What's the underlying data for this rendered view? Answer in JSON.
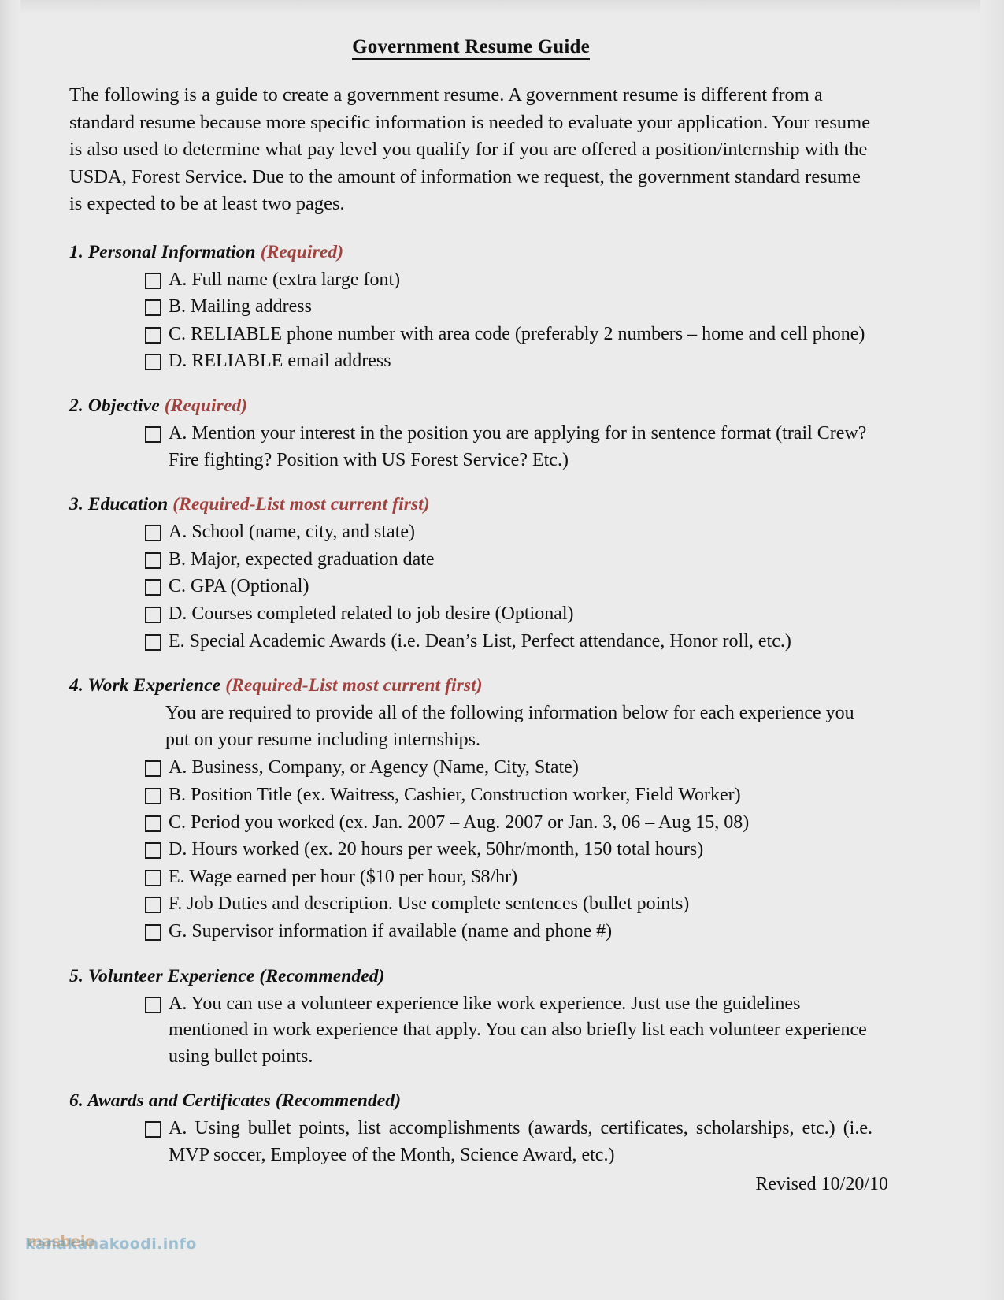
{
  "document": {
    "title": "Government Resume Guide",
    "intro": "The following is a guide to create a government resume. A government resume is different from a standard resume because more specific information is needed to evaluate your application. Your resume is also used to determine what pay level you qualify for if you are offered a position/internship with the USDA, Forest Service. Due to the amount of information we request, the government standard resume is expected to be at least two pages.",
    "revised": "Revised 10/20/10"
  },
  "colors": {
    "page_background": "#ebebeb",
    "text": "#111111",
    "required_accent": "#a2423f"
  },
  "sections": [
    {
      "number": "1.",
      "title": "Personal Information",
      "qualifier": "(Required)",
      "qualifier_color": "red",
      "note": "",
      "items": [
        "A. Full name (extra large font)",
        "B. Mailing address",
        "C. RELIABLE phone number with area code (preferably 2 numbers – home and cell phone)",
        "D. RELIABLE email address"
      ]
    },
    {
      "number": "2.",
      "title": "Objective",
      "qualifier": "(Required)",
      "qualifier_color": "red",
      "note": "",
      "items": [
        "A. Mention your interest in the position you are applying for in sentence format (trail Crew? Fire fighting? Position with US Forest Service? Etc.)"
      ]
    },
    {
      "number": "3.",
      "title": "Education",
      "qualifier": "(Required-List most current first)",
      "qualifier_color": "red",
      "note": "",
      "items": [
        "A. School (name, city, and state)",
        "B. Major, expected graduation date",
        "C. GPA (Optional)",
        "D. Courses completed related to job desire (Optional)",
        "E. Special Academic Awards (i.e. Dean’s List, Perfect attendance, Honor roll, etc.)"
      ]
    },
    {
      "number": "4.",
      "title": "Work Experience",
      "qualifier": "(Required-List most current first)",
      "qualifier_color": "red",
      "note": "You are required to provide all of the following information below for each experience you put on your resume including internships.",
      "items": [
        "A. Business, Company, or Agency (Name, City, State)",
        "B. Position Title (ex. Waitress, Cashier, Construction worker, Field Worker)",
        "C. Period you worked (ex. Jan. 2007 – Aug. 2007 or Jan. 3, 06 – Aug 15, 08)",
        "D. Hours worked (ex. 20 hours per week, 50hr/month, 150 total hours)",
        "E. Wage earned per hour ($10 per hour, $8/hr)",
        "F. Job Duties and description. Use complete sentences (bullet points)",
        "G. Supervisor information if available (name and phone #)"
      ]
    },
    {
      "number": "5.",
      "title": "Volunteer Experience",
      "qualifier": "(Recommended)",
      "qualifier_color": "black",
      "note": "",
      "items": [
        "A. You can use a volunteer experience like work experience. Just use the guidelines mentioned in work experience that apply. You can also briefly list each volunteer experience using bullet points."
      ]
    },
    {
      "number": "6.",
      "title": "Awards and Certificates",
      "qualifier": "(Recommended)",
      "qualifier_color": "black",
      "note": "",
      "items": [
        "A. Using bullet points, list accomplishments (awards, certificates, scholarships, etc.) (i.e. MVP soccer, Employee of the Month, Science Award, etc.)"
      ]
    }
  ],
  "watermark": {
    "line_a": "masbeio",
    "line_b": "kanakanakoodi.info"
  }
}
